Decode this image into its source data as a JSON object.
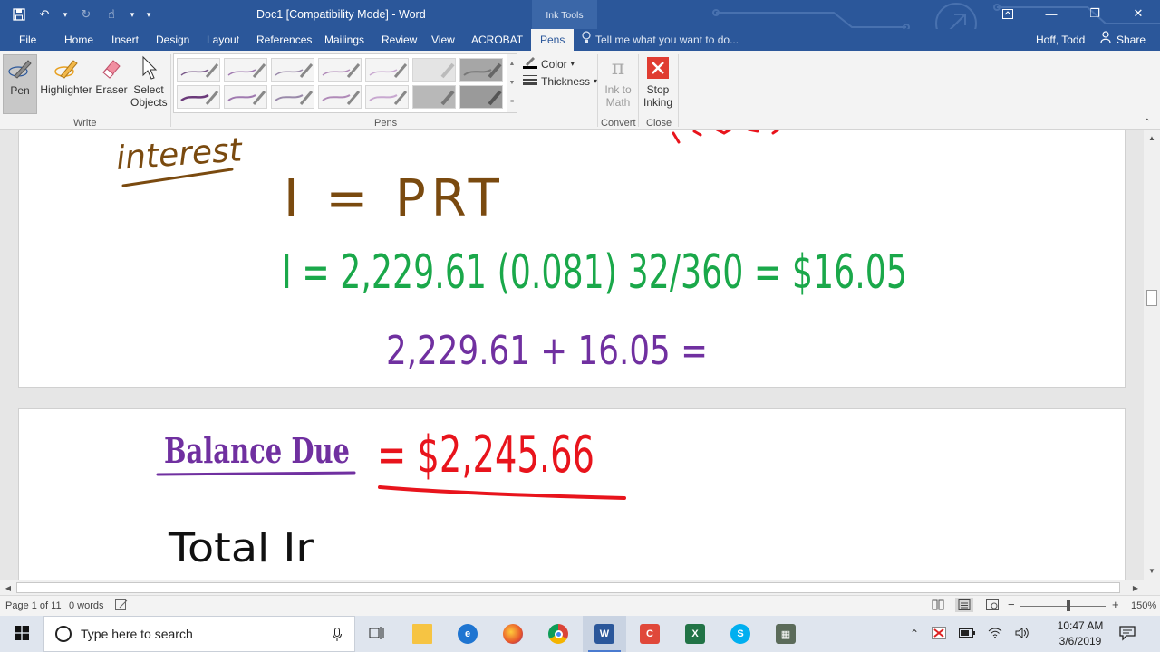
{
  "titlebar": {
    "title": "Doc1 [Compatibility Mode] - Word",
    "context_tab": "Ink Tools"
  },
  "tabs": [
    {
      "label": "File"
    },
    {
      "label": "Home"
    },
    {
      "label": "Insert"
    },
    {
      "label": "Design"
    },
    {
      "label": "Layout"
    },
    {
      "label": "References"
    },
    {
      "label": "Mailings"
    },
    {
      "label": "Review"
    },
    {
      "label": "View"
    },
    {
      "label": "ACROBAT"
    },
    {
      "label": "Pens"
    }
  ],
  "tell_me": "Tell me what you want to do...",
  "user": "Hoff, Todd",
  "share": "Share",
  "ribbon": {
    "write": {
      "pen": "Pen",
      "highlighter": "Highlighter",
      "eraser": "Eraser",
      "select_line1": "Select",
      "select_line2": "Objects",
      "group": "Write"
    },
    "pens_group": "Pens",
    "color": "Color",
    "thickness": "Thickness",
    "ink_to_math_line1": "Ink to",
    "ink_to_math_line2": "Math",
    "convert_group": "Convert",
    "stop_inking_line1": "Stop",
    "stop_inking_line2": "Inking",
    "close_group": "Close"
  },
  "ink": {
    "interest_label": "interest",
    "formula": "I = PRT",
    "calc": "I = 2,229.61 (0.081) 32/360 = $16.05",
    "sum": "2,229.61 + 16.05 =",
    "balance_label": "Balance Due",
    "balance_value": "= $2,245.66",
    "total_label": "Total Ir"
  },
  "status": {
    "page": "Page 1 of 11",
    "words": "0 words",
    "zoom": "150%"
  },
  "taskbar": {
    "search_placeholder": "Type here to search",
    "time": "10:47 AM",
    "date": "3/6/2019"
  },
  "colors": {
    "word_blue": "#2b579a",
    "ink_brown": "#7a4a0f",
    "ink_green": "#1aa84a",
    "ink_purple": "#7030a0",
    "ink_red": "#e8141c",
    "ink_black": "#111111"
  }
}
